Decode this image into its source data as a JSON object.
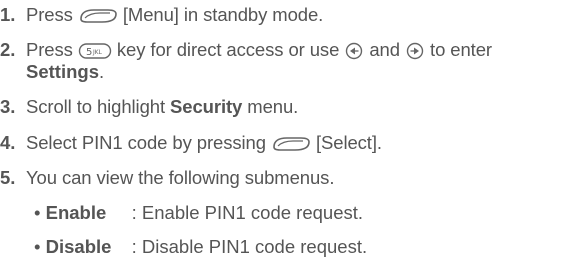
{
  "steps": [
    {
      "num": "1.",
      "a": "Press",
      "icon_1": "menu-softkey-icon",
      "b": "[Menu] in standby mode."
    },
    {
      "num": "2.",
      "a": "Press",
      "icon_1": "key-5-jkl-icon",
      "b": "key for direct access or use",
      "icon_2": "nav-left-icon",
      "c": "and",
      "icon_3": "nav-right-icon",
      "d": "to enter",
      "bold": "Settings",
      "e": "."
    },
    {
      "num": "3.",
      "a": "Scroll to highlight",
      "bold": "Security",
      "b": "menu."
    },
    {
      "num": "4.",
      "a": "Select PIN1 code by pressing",
      "icon_1": "select-softkey-icon",
      "b": "[Select]."
    },
    {
      "num": "5.",
      "a": "You can view the following submenus."
    }
  ],
  "submenus": [
    {
      "bullet": "•",
      "term": "Enable",
      "desc": ": Enable PIN1 code request."
    },
    {
      "bullet": "•",
      "term": "Disable",
      "desc": ": Disable PIN1 code request."
    }
  ],
  "colors": {
    "text": "#555555",
    "icon": "#666666"
  }
}
